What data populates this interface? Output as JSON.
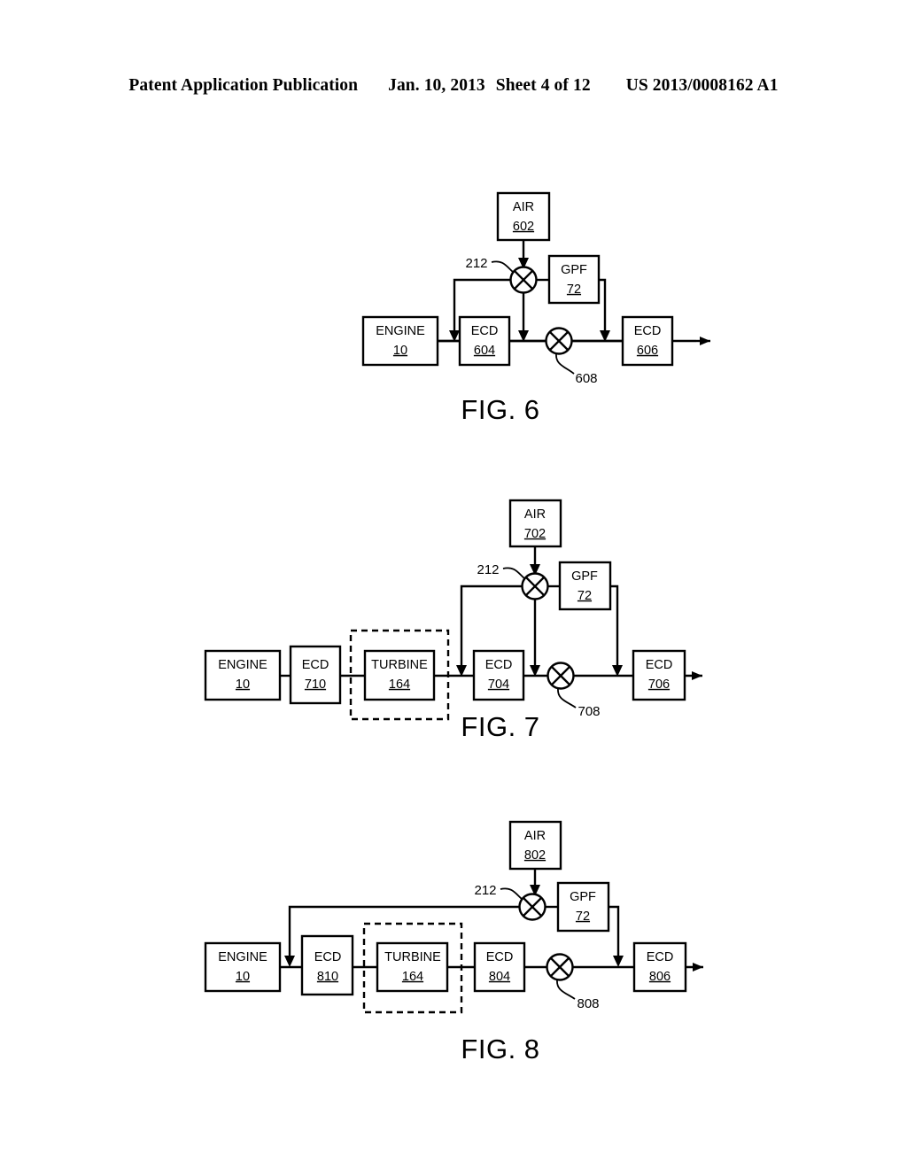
{
  "header": {
    "publication": "Patent Application Publication",
    "date": "Jan. 10, 2013",
    "sheet": "Sheet 4 of 12",
    "patent_number": "US 2013/0008162 A1"
  },
  "figures": [
    {
      "caption": "FIG. 6",
      "boxes": {
        "engine": {
          "label": "ENGINE",
          "num": "10"
        },
        "ecd_first": {
          "label": "ECD",
          "num": "604"
        },
        "ecd_last": {
          "label": "ECD",
          "num": "606"
        },
        "air": {
          "label": "AIR",
          "num": "602"
        },
        "gpf": {
          "label": "GPF",
          "num": "72"
        }
      },
      "mixers": {
        "upper": "212",
        "lower": "608"
      }
    },
    {
      "caption": "FIG. 7",
      "boxes": {
        "engine": {
          "label": "ENGINE",
          "num": "10"
        },
        "ecd_pre": {
          "label": "ECD",
          "num": "710"
        },
        "turbine": {
          "label": "TURBINE",
          "num": "164"
        },
        "ecd_first": {
          "label": "ECD",
          "num": "704"
        },
        "ecd_last": {
          "label": "ECD",
          "num": "706"
        },
        "air": {
          "label": "AIR",
          "num": "702"
        },
        "gpf": {
          "label": "GPF",
          "num": "72"
        }
      },
      "mixers": {
        "upper": "212",
        "lower": "708"
      }
    },
    {
      "caption": "FIG. 8",
      "boxes": {
        "engine": {
          "label": "ENGINE",
          "num": "10"
        },
        "ecd_pre": {
          "label": "ECD",
          "num": "810"
        },
        "turbine": {
          "label": "TURBINE",
          "num": "164"
        },
        "ecd_first": {
          "label": "ECD",
          "num": "804"
        },
        "ecd_last": {
          "label": "ECD",
          "num": "806"
        },
        "air": {
          "label": "AIR",
          "num": "802"
        },
        "gpf": {
          "label": "GPF",
          "num": "72"
        }
      },
      "mixers": {
        "upper": "212",
        "lower": "808"
      }
    }
  ]
}
